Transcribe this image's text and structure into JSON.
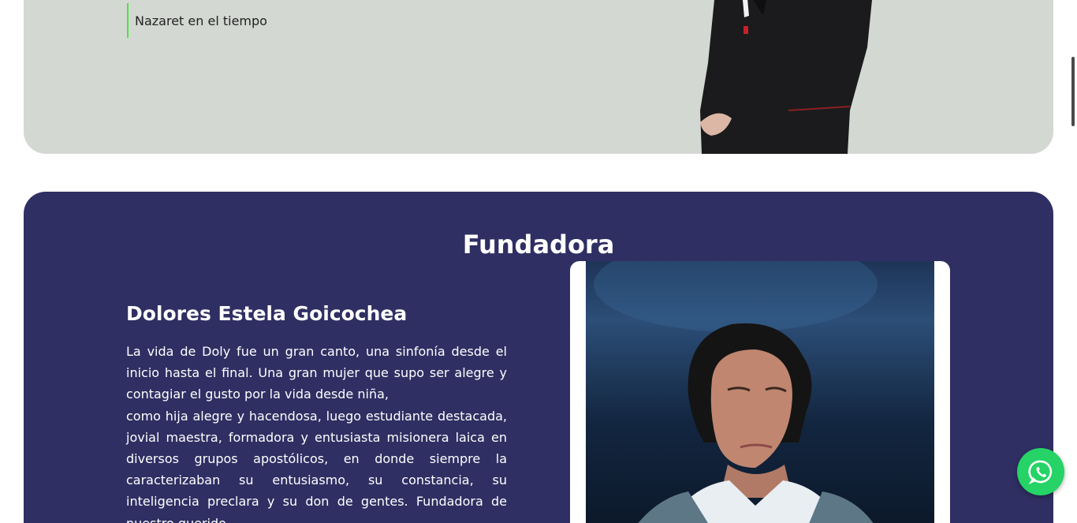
{
  "top_section": {
    "nav_items": [
      {
        "label": ""
      },
      {
        "label": "Nazaret en el tiempo"
      }
    ]
  },
  "founder_section": {
    "title": "Fundadora",
    "name": "Dolores Estela Goicochea",
    "bio_paragraphs": [
      "La vida de Doly fue un gran canto, una sinfonía desde el inicio hasta el final. Una gran mujer que supo ser alegre y contagiar el gusto por la vida desde niña,",
      "como hija alegre y hacendosa, luego estudiante destacada, jovial maestra, formadora y entusiasta misionera laica en diversos grupos apostólicos, en donde siempre la caracterizaban su entusiasmo, su constancia, su inteligencia preclara y su don de gentes. Fundadora de nuestro querido"
    ]
  },
  "floating": {
    "whatsapp_icon": "whatsapp-icon",
    "accent": "#25d366"
  },
  "colors": {
    "top_card_bg": "#d4d8d3",
    "nav_border": "#49e63b",
    "founder_bg": "#2f2f63"
  }
}
